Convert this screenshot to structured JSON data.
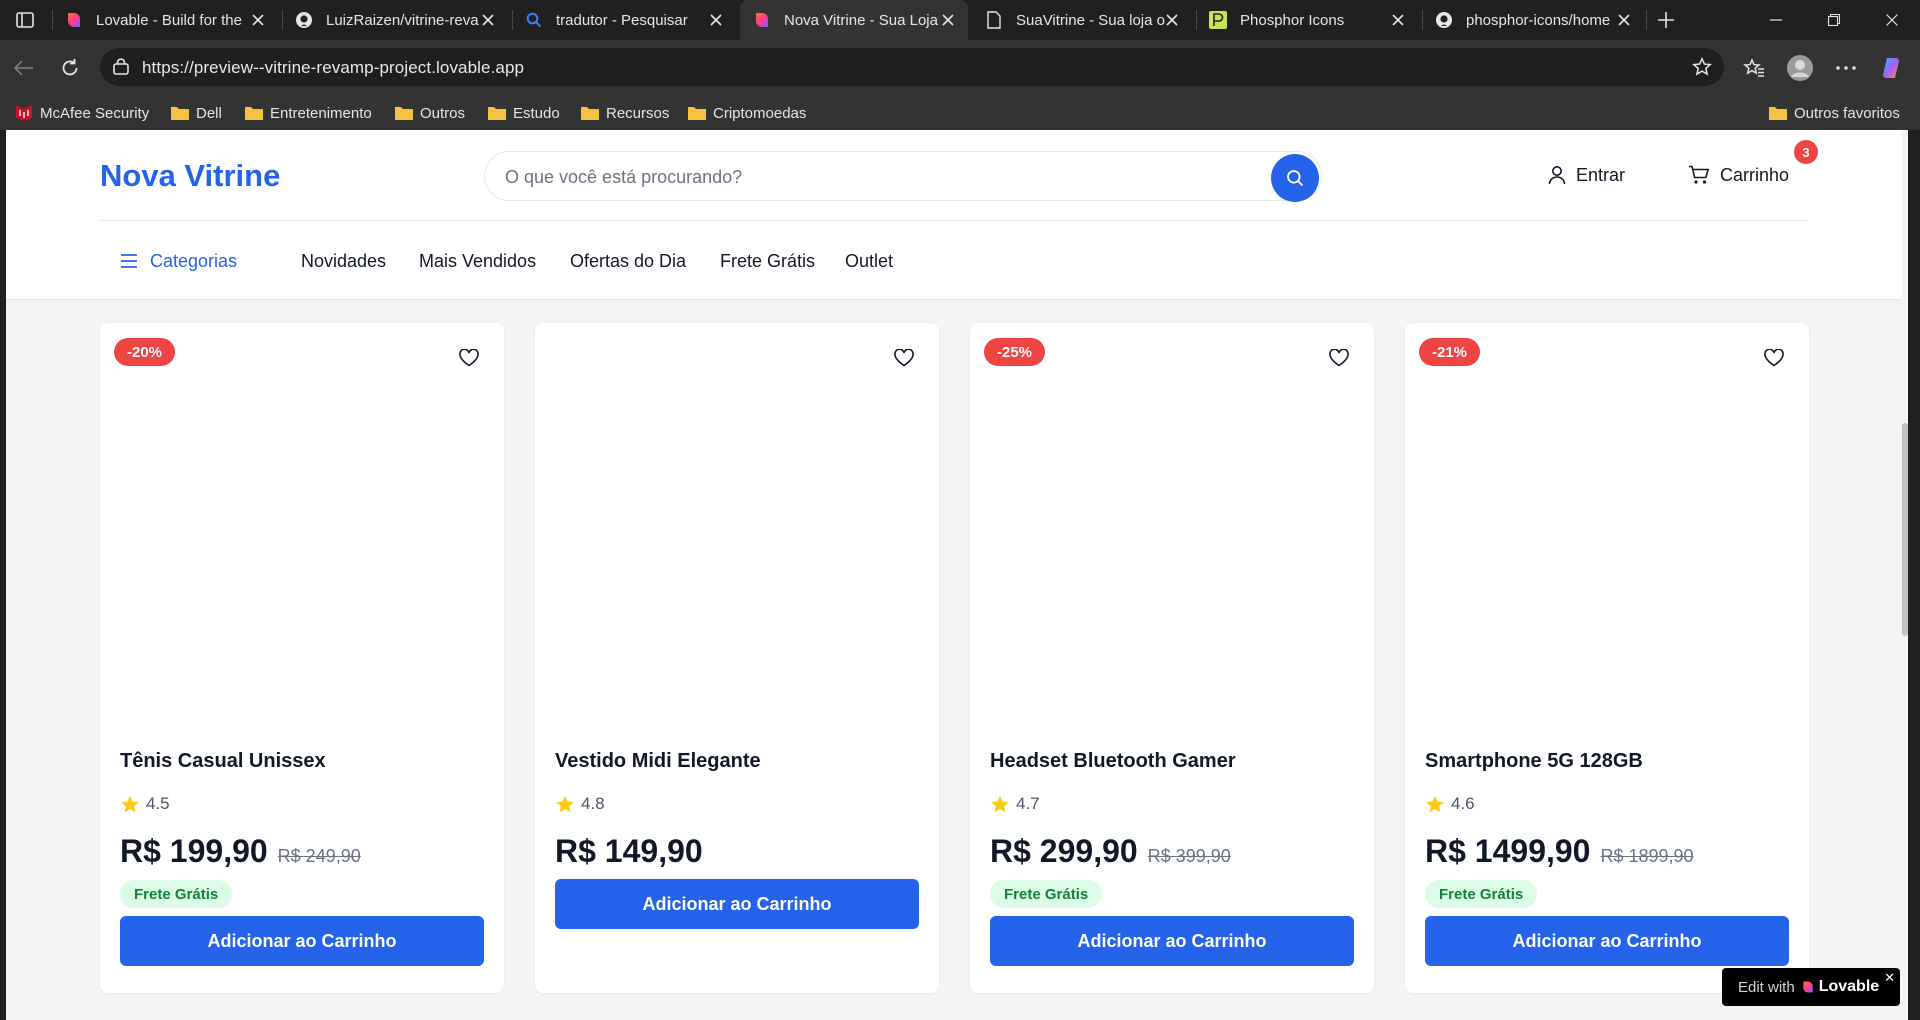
{
  "browser": {
    "tabs": [
      {
        "title": "Lovable - Build for the",
        "icon": "lovable-icon"
      },
      {
        "title": "LuizRaizen/vitrine-reva",
        "icon": "github-icon"
      },
      {
        "title": "tradutor - Pesquisar",
        "icon": "search-icon"
      },
      {
        "title": "Nova Vitrine - Sua Loja",
        "icon": "lovable-icon",
        "active": true
      },
      {
        "title": "SuaVitrine - Sua loja o",
        "icon": "page-icon"
      },
      {
        "title": "Phosphor Icons",
        "icon": "phosphor-icon"
      },
      {
        "title": "phosphor-icons/home",
        "icon": "github-icon"
      }
    ],
    "url": "https://preview--vitrine-revamp-project.lovable.app",
    "bookmarks": [
      {
        "label": "McAfee Security",
        "icon": "mcafee-icon"
      },
      {
        "label": "Dell",
        "icon": "folder-icon"
      },
      {
        "label": "Entretenimento",
        "icon": "folder-icon"
      },
      {
        "label": "Outros",
        "icon": "folder-icon"
      },
      {
        "label": "Estudo",
        "icon": "folder-icon"
      },
      {
        "label": "Recursos",
        "icon": "folder-icon"
      },
      {
        "label": "Criptomoedas",
        "icon": "folder-icon"
      }
    ],
    "other_bookmarks": "Outros favoritos"
  },
  "site": {
    "logo": "Nova Vitrine",
    "search_placeholder": "O que você está procurando?",
    "login_label": "Entrar",
    "cart_label": "Carrinho",
    "cart_count": "3",
    "categories_label": "Categorias",
    "nav": [
      "Novidades",
      "Mais Vendidos",
      "Ofertas do Dia",
      "Frete Grátis",
      "Outlet"
    ],
    "brand_color": "#2563eb"
  },
  "products": [
    {
      "discount": "-20%",
      "name": "Tênis Casual Unissex",
      "rating": "4.5",
      "price": "R$ 199,90",
      "old_price": "R$ 249,90",
      "shipping": "Frete Grátis",
      "button": "Adicionar ao Carrinho"
    },
    {
      "discount": "",
      "name": "Vestido Midi Elegante",
      "rating": "4.8",
      "price": "R$ 149,90",
      "old_price": "",
      "shipping": "",
      "button": "Adicionar ao Carrinho"
    },
    {
      "discount": "-25%",
      "name": "Headset Bluetooth Gamer",
      "rating": "4.7",
      "price": "R$ 299,90",
      "old_price": "R$ 399,90",
      "shipping": "Frete Grátis",
      "button": "Adicionar ao Carrinho"
    },
    {
      "discount": "-21%",
      "name": "Smartphone 5G 128GB",
      "rating": "4.6",
      "price": "R$ 1499,90",
      "old_price": "R$ 1899,90",
      "shipping": "Frete Grátis",
      "button": "Adicionar ao Carrinho"
    }
  ],
  "lovable_badge": {
    "edit_label": "Edit with",
    "brand": "Lovable"
  }
}
